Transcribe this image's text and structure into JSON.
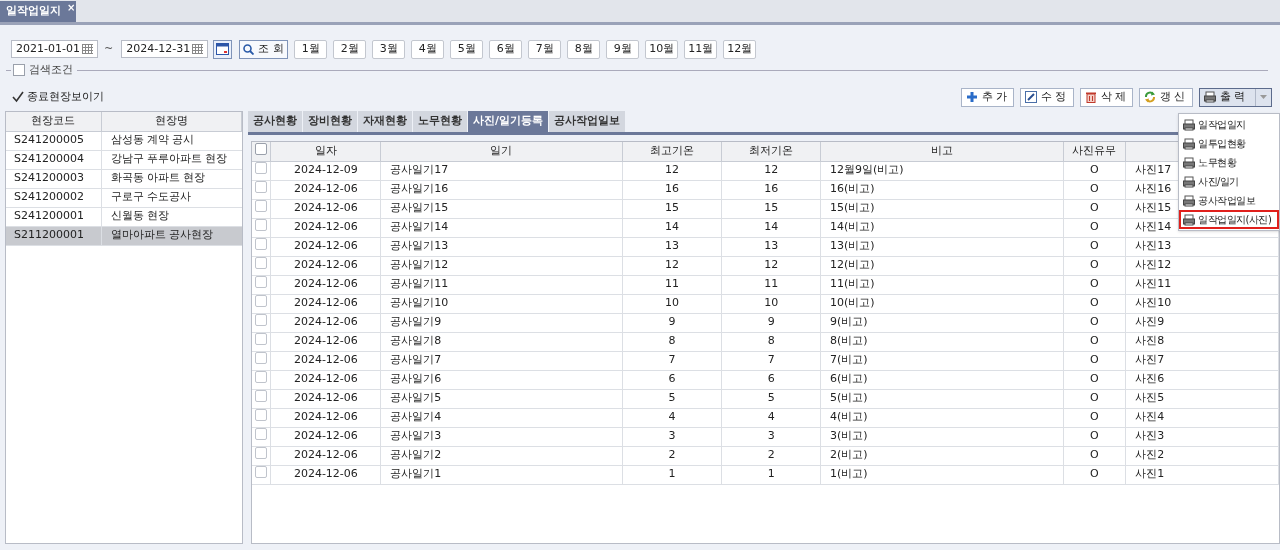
{
  "window_tab": {
    "label": "일작업일지",
    "close": "×"
  },
  "date_from": "2021-01-01",
  "separator": "~",
  "date_to": "2024-12-31",
  "search_button": "조 회",
  "months": [
    "1월",
    "2월",
    "3월",
    "4월",
    "5월",
    "6월",
    "7월",
    "8월",
    "9월",
    "10월",
    "11월",
    "12월"
  ],
  "search_conditions": {
    "label": "검색조건",
    "checked": false
  },
  "show_closed": {
    "label": "종료현장보이기",
    "checked": true
  },
  "actions": [
    {
      "kind": "add",
      "label": "추 가"
    },
    {
      "kind": "edit",
      "label": "수 정"
    },
    {
      "kind": "delete",
      "label": "삭 제"
    },
    {
      "kind": "refresh",
      "label": "갱 신"
    },
    {
      "kind": "print",
      "label": "출 력"
    }
  ],
  "sites": {
    "columns": [
      "현장코드",
      "현장명"
    ],
    "rows": [
      {
        "code": "S241200005",
        "name": "삼성동 계약 공시",
        "selected": false
      },
      {
        "code": "S241200004",
        "name": "강남구 푸루아파트 현장",
        "selected": false
      },
      {
        "code": "S241200003",
        "name": "화곡동 아파트 현장",
        "selected": false
      },
      {
        "code": "S241200002",
        "name": "구로구 수도공사",
        "selected": false
      },
      {
        "code": "S241200001",
        "name": "신월동 현장",
        "selected": false
      },
      {
        "code": "S211200001",
        "name": "열마아파트 공사현장",
        "selected": true
      }
    ]
  },
  "tabs": [
    {
      "label": "공사현황",
      "selected": false
    },
    {
      "label": "장비현황",
      "selected": false
    },
    {
      "label": "자재현황",
      "selected": false
    },
    {
      "label": "노무현황",
      "selected": false
    },
    {
      "label": "사진/일기등록",
      "selected": true
    },
    {
      "label": "공사작업일보",
      "selected": false
    }
  ],
  "grid": {
    "header_checked": false,
    "columns": [
      "일자",
      "일기",
      "최고기온",
      "최저기온",
      "비고",
      "사진유무"
    ],
    "rows": [
      {
        "checked": false,
        "cells": [
          "2024-12-09",
          "공사일기17",
          "12",
          "12",
          "12월9일(비고)",
          "O",
          "사진17"
        ]
      },
      {
        "checked": false,
        "cells": [
          "2024-12-06",
          "공사일기16",
          "16",
          "16",
          "16(비고)",
          "O",
          "사진16"
        ]
      },
      {
        "checked": false,
        "cells": [
          "2024-12-06",
          "공사일기15",
          "15",
          "15",
          "15(비고)",
          "O",
          "사진15"
        ]
      },
      {
        "checked": false,
        "cells": [
          "2024-12-06",
          "공사일기14",
          "14",
          "14",
          "14(비고)",
          "O",
          "사진14"
        ]
      },
      {
        "checked": false,
        "cells": [
          "2024-12-06",
          "공사일기13",
          "13",
          "13",
          "13(비고)",
          "O",
          "사진13"
        ]
      },
      {
        "checked": false,
        "cells": [
          "2024-12-06",
          "공사일기12",
          "12",
          "12",
          "12(비고)",
          "O",
          "사진12"
        ]
      },
      {
        "checked": false,
        "cells": [
          "2024-12-06",
          "공사일기11",
          "11",
          "11",
          "11(비고)",
          "O",
          "사진11"
        ]
      },
      {
        "checked": false,
        "cells": [
          "2024-12-06",
          "공사일기10",
          "10",
          "10",
          "10(비고)",
          "O",
          "사진10"
        ]
      },
      {
        "checked": false,
        "cells": [
          "2024-12-06",
          "공사일기9",
          "9",
          "9",
          "9(비고)",
          "O",
          "사진9"
        ]
      },
      {
        "checked": false,
        "cells": [
          "2024-12-06",
          "공사일기8",
          "8",
          "8",
          "8(비고)",
          "O",
          "사진8"
        ]
      },
      {
        "checked": false,
        "cells": [
          "2024-12-06",
          "공사일기7",
          "7",
          "7",
          "7(비고)",
          "O",
          "사진7"
        ]
      },
      {
        "checked": false,
        "cells": [
          "2024-12-06",
          "공사일기6",
          "6",
          "6",
          "6(비고)",
          "O",
          "사진6"
        ]
      },
      {
        "checked": false,
        "cells": [
          "2024-12-06",
          "공사일기5",
          "5",
          "5",
          "5(비고)",
          "O",
          "사진5"
        ]
      },
      {
        "checked": false,
        "cells": [
          "2024-12-06",
          "공사일기4",
          "4",
          "4",
          "4(비고)",
          "O",
          "사진4"
        ]
      },
      {
        "checked": false,
        "cells": [
          "2024-12-06",
          "공사일기3",
          "3",
          "3",
          "3(비고)",
          "O",
          "사진3"
        ]
      },
      {
        "checked": false,
        "cells": [
          "2024-12-06",
          "공사일기2",
          "2",
          "2",
          "2(비고)",
          "O",
          "사진2"
        ]
      },
      {
        "checked": false,
        "cells": [
          "2024-12-06",
          "공사일기1",
          "1",
          "1",
          "1(비고)",
          "O",
          "사진1"
        ]
      }
    ]
  },
  "print_menu": [
    {
      "label": "일작업일지",
      "selected": false
    },
    {
      "label": "일투입현황",
      "selected": false
    },
    {
      "label": "노무현황",
      "selected": false
    },
    {
      "label": "사진/일기",
      "selected": false
    },
    {
      "label": "공사작업일보",
      "selected": false
    },
    {
      "label": "일작업일지(사진)",
      "selected": true
    }
  ]
}
